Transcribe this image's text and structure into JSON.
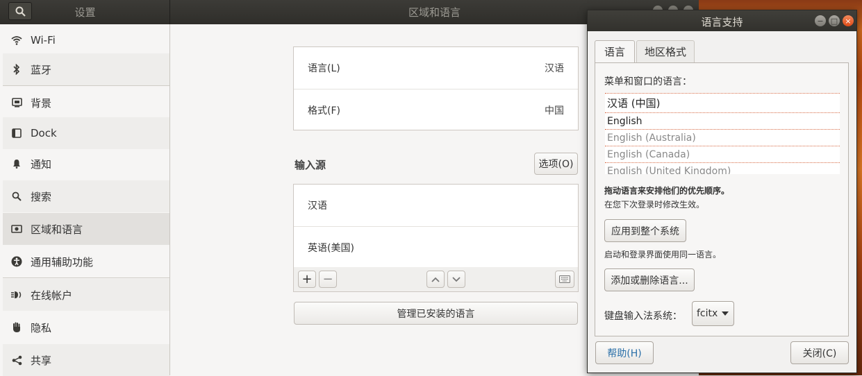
{
  "settings": {
    "sidebar_title": "设置",
    "title": "区域和语言",
    "sidebar": [
      {
        "name": "wifi",
        "label": "Wi-Fi",
        "icon": "wifi-icon"
      },
      {
        "name": "bluetooth",
        "label": "蓝牙",
        "icon": "bluetooth-icon"
      },
      {
        "name": "background",
        "label": "背景",
        "icon": "background-icon"
      },
      {
        "name": "dock",
        "label": "Dock",
        "icon": "dock-icon"
      },
      {
        "name": "notifications",
        "label": "通知",
        "icon": "bell-icon"
      },
      {
        "name": "search",
        "label": "搜索",
        "icon": "search-icon"
      },
      {
        "name": "region",
        "label": "区域和语言",
        "icon": "region-icon",
        "selected": true
      },
      {
        "name": "accessibility",
        "label": "通用辅助功能",
        "icon": "accessibility-icon"
      },
      {
        "name": "online-accounts",
        "label": "在线帐户",
        "icon": "online-accounts-icon"
      },
      {
        "name": "privacy",
        "label": "隐私",
        "icon": "hand-icon"
      },
      {
        "name": "sharing",
        "label": "共享",
        "icon": "share-icon"
      }
    ],
    "language": {
      "label": "语言(L)",
      "value": "汉语"
    },
    "format": {
      "label": "格式(F)",
      "value": "中国"
    },
    "input_sources": {
      "title": "输入源",
      "options_button": "选项(O)",
      "items": [
        "汉语",
        "英语(美国)"
      ]
    },
    "manage_languages_button": "管理已安装的语言"
  },
  "dialog": {
    "title": "语言支持",
    "tabs": [
      "语言",
      "地区格式"
    ],
    "menu_language_label": "菜单和窗口的语言：",
    "languages": [
      "汉语 (中国)",
      "English",
      "English (Australia)",
      "English (Canada)",
      "English (United Kingdom)"
    ],
    "drag_hint": "拖动语言来安排他们的优先顺序。",
    "effect_hint": "在您下次登录时修改生效。",
    "apply_button": "应用到整个系统",
    "apply_hint": "启动和登录界面使用同一语言。",
    "add_remove_button": "添加或删除语言...",
    "input_method_label": "键盘输入法系统：",
    "input_method_value": "fcitx",
    "help_button": "帮助(H)",
    "close_button": "关闭(C)"
  }
}
